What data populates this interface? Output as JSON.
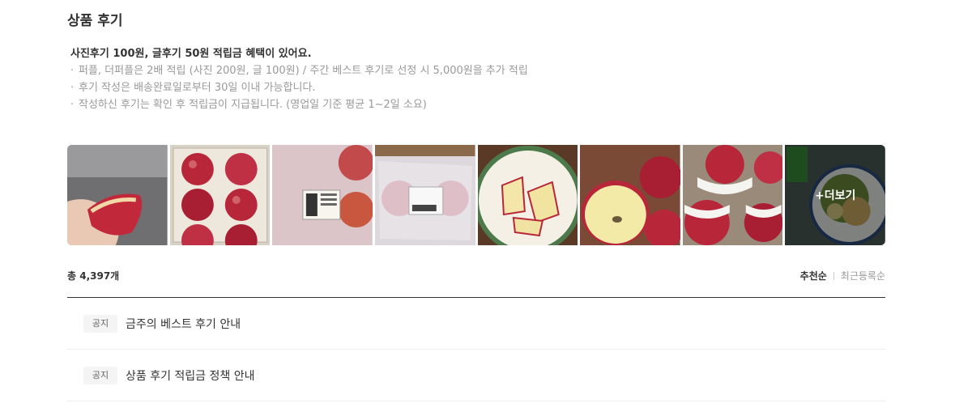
{
  "section": {
    "title": "상품 후기"
  },
  "benefit": {
    "headline": "사진후기 100원, 글후기 50원 적립금 혜택이 있어요.",
    "items": [
      "퍼플, 더퍼플은 2배 적립 (사진 200원, 글 100원) / 주간 베스트 후기로 선정 시 5,000원을 추가 적립",
      "후기 작성은 배송완료일로부터 30일 이내 가능합니다.",
      "작성하신 후기는 확인 후 적립금이 지급됩니다. (영업일 기준 평균 1~2일 소요)"
    ]
  },
  "gallery": {
    "thumbs": [
      "hand-holding-apple-peel-photo",
      "apples-in-tray-photo",
      "packaged-apples-label-photo",
      "wrapped-apple-box-photo",
      "sliced-apple-plate-photo",
      "cut-apple-closeup-photo",
      "apples-with-foam-nets-photo",
      "salad-plate-photo"
    ],
    "more_label": "+더보기"
  },
  "toolbar": {
    "total": "총 4,397개",
    "sort_recommended": "추천순",
    "sort_recent": "최근등록순"
  },
  "notices": [
    {
      "badge": "공지",
      "title": "금주의 베스트 후기 안내"
    },
    {
      "badge": "공지",
      "title": "상품 후기 적립금 정책 안내"
    }
  ],
  "colors": {
    "text_primary": "#333333",
    "text_muted": "#999999",
    "apple_red": "#b8263a",
    "badge_bg": "#f4f4f4"
  }
}
